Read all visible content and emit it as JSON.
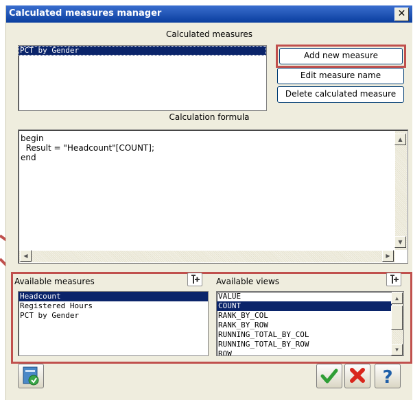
{
  "window": {
    "title": "Calculated measures manager",
    "close_label": "✕"
  },
  "measures": {
    "heading": "Calculated measures",
    "items": [
      "PCT by Gender"
    ],
    "buttons": {
      "add": "Add new measure",
      "edit": "Edit measure name",
      "delete": "Delete calculated measure"
    }
  },
  "formula": {
    "heading": "Calculation formula",
    "lines": [
      "begin",
      "  Result = \"Headcount\"[COUNT];",
      "end"
    ]
  },
  "available_measures": {
    "heading": "Available measures",
    "items": [
      "Headcount",
      "Registered Hours",
      "PCT by Gender"
    ]
  },
  "available_views": {
    "heading": "Available views",
    "items": [
      "VALUE",
      "COUNT",
      "RANK_BY_COL",
      "RANK_BY_ROW",
      "RUNNING_TOTAL_BY_COL",
      "RUNNING_TOTAL_BY_ROW",
      "ROW"
    ]
  },
  "colors": {
    "highlight_red": "#c0504d",
    "selection": "#0a246a",
    "title_bar": "#0a3e9e"
  }
}
